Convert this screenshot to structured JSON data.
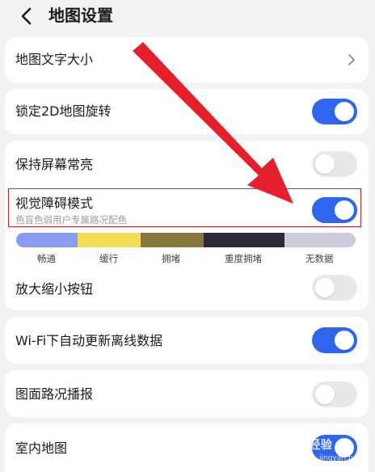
{
  "header": {
    "title": "地图设置"
  },
  "items": {
    "text_size": {
      "label": "地图文字大小"
    },
    "lock_2d": {
      "label": "锁定2D地图旋转",
      "enabled": true
    },
    "screen_on": {
      "label": "保持屏幕常亮",
      "enabled": false
    },
    "accessibility": {
      "label": "视觉障碍模式",
      "sublabel": "色盲色弱用户专属路况配色",
      "enabled": true
    },
    "zoom_buttons": {
      "label": "放大缩小按钮",
      "enabled": false
    },
    "wifi_update": {
      "label": "Wi-Fi下自动更新离线数据",
      "enabled": true
    },
    "traffic_broadcast": {
      "label": "图面路况播报",
      "enabled": false
    },
    "indoor_map": {
      "label": "室内地图",
      "enabled": true
    }
  },
  "legend": [
    {
      "label": "畅通",
      "color": "#8a9cf0"
    },
    {
      "label": "缓行",
      "color": "#f5dc56"
    },
    {
      "label": "拥堵",
      "color": "#86773c"
    },
    {
      "label": "重度拥堵",
      "color": "#2b2a34"
    },
    {
      "label": "无数据",
      "color": "#cbcbdc"
    }
  ],
  "colors": {
    "accent": "#2f66f0",
    "annotation": "#e5202a",
    "highlight": "#d8222a"
  },
  "watermark": {
    "text": "Baidu经验",
    "sub": "jingyan.baidu.com"
  }
}
